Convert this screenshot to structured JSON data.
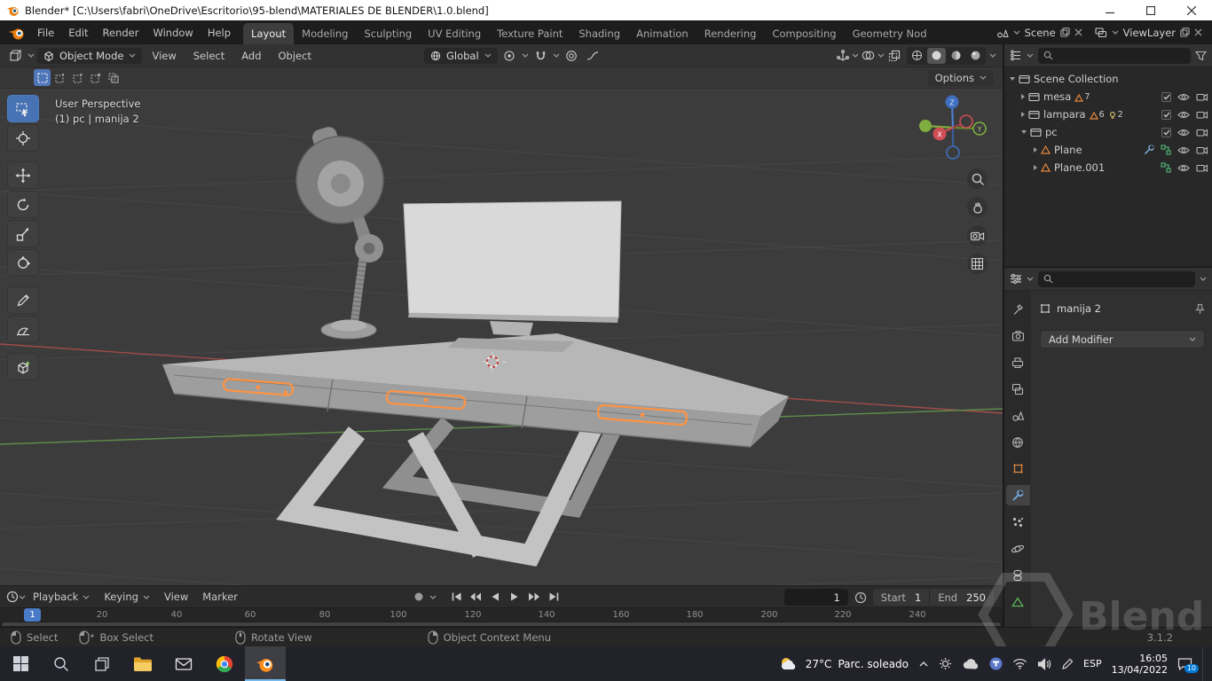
{
  "window": {
    "title": "Blender* [C:\\Users\\fabri\\OneDrive\\Escritorio\\95-blend\\MATERIALES DE BLENDER\\1.0.blend]"
  },
  "topbar": {
    "menus": [
      "File",
      "Edit",
      "Render",
      "Window",
      "Help"
    ],
    "workspaces": [
      "Layout",
      "Modeling",
      "Sculpting",
      "UV Editing",
      "Texture Paint",
      "Shading",
      "Animation",
      "Rendering",
      "Compositing",
      "Geometry Nod"
    ],
    "scene_label": "Scene",
    "viewlayer_label": "ViewLayer"
  },
  "viewport_header": {
    "mode": "Object Mode",
    "menus": [
      "View",
      "Select",
      "Add",
      "Object"
    ],
    "orientation": "Global",
    "options": "Options"
  },
  "viewport": {
    "overlay_line1": "User Perspective",
    "overlay_line2": "(1) pc | manija 2",
    "axis_x": "X",
    "axis_y": "Y",
    "axis_z": "Z"
  },
  "outliner": {
    "rows": [
      {
        "label": "Scene Collection"
      },
      {
        "label": "mesa",
        "mesh_count": "7"
      },
      {
        "label": "lampara",
        "mesh_count": "6",
        "light_count": "2"
      },
      {
        "label": "pc"
      },
      {
        "label": "Plane"
      },
      {
        "label": "Plane.001"
      }
    ]
  },
  "properties": {
    "object_name": "manija 2",
    "add_modifier": "Add Modifier"
  },
  "timeline": {
    "menus": [
      "Playback",
      "Keying",
      "View",
      "Marker"
    ],
    "current_frame": "1",
    "start_label": "Start",
    "start_value": "1",
    "end_label": "End",
    "end_value": "250",
    "playhead": "1",
    "ruler": [
      "20",
      "40",
      "60",
      "80",
      "100",
      "120",
      "140",
      "160",
      "180",
      "200",
      "220",
      "240"
    ]
  },
  "statusbar": {
    "hints": [
      "Select",
      "Box Select",
      "Rotate View",
      "Object Context Menu"
    ],
    "version": "3.1.2"
  },
  "taskbar": {
    "weather_temp": "27°C",
    "weather_desc": "Parc. soleado",
    "lang": "ESP",
    "time": "16:05",
    "date": "13/04/2022",
    "notification_count": "10"
  },
  "watermark": {
    "text": "Blend"
  },
  "colors": {
    "accent_orange": "#ff9240",
    "accent_blue": "#4772b3"
  }
}
